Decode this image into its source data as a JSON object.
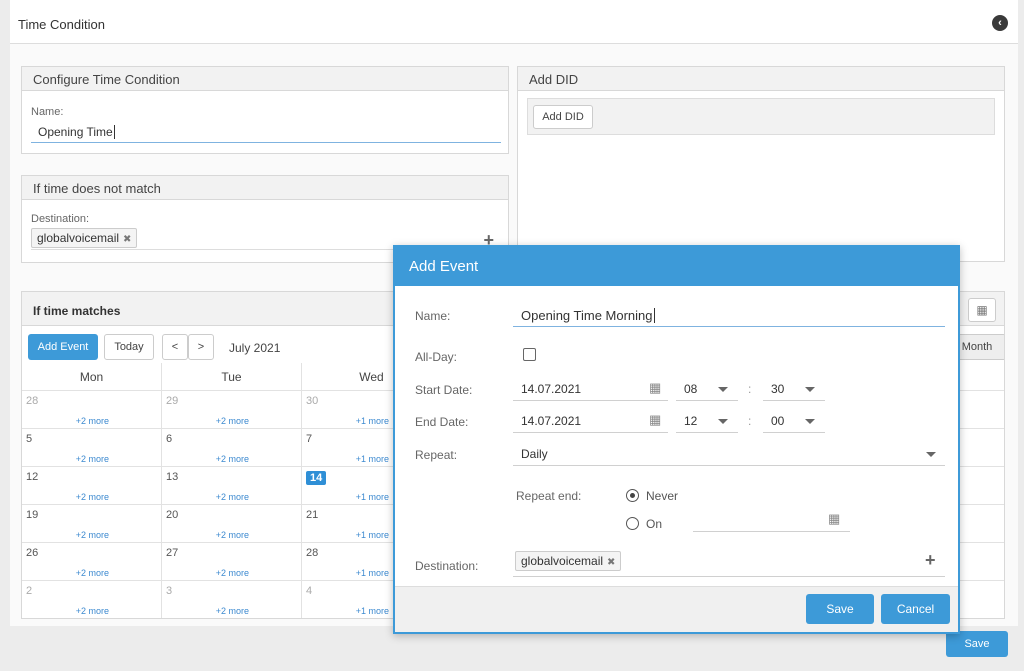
{
  "header": {
    "title": "Time Condition",
    "back_icon": "back-circle-icon"
  },
  "configure": {
    "title": "Configure Time Condition",
    "name_label": "Name:",
    "name_value": "Opening Time"
  },
  "add_did": {
    "title": "Add DID",
    "button": "Add DID"
  },
  "no_match": {
    "title": "If time does not match",
    "destination_label": "Destination:",
    "destination_tag": "globalvoicemail",
    "remove_glyph": "✖",
    "add_glyph": "+"
  },
  "matches": {
    "title": "If time matches",
    "add_event": "Add Event",
    "today": "Today",
    "prev": "<",
    "next": ">",
    "period": "July 2021",
    "view_month": "Month",
    "grid_icon": "grid-icon",
    "weekdays": [
      "Mon",
      "Tue",
      "Wed"
    ],
    "weeks": [
      [
        {
          "n": "28",
          "more": "+2 more",
          "dim": true
        },
        {
          "n": "29",
          "more": "+2 more",
          "dim": true
        },
        {
          "n": "30",
          "more": "+1 more",
          "dim": true
        }
      ],
      [
        {
          "n": "5",
          "more": "+2 more"
        },
        {
          "n": "6",
          "more": "+2 more"
        },
        {
          "n": "7",
          "more": "+1 more"
        }
      ],
      [
        {
          "n": "12",
          "more": "+2 more"
        },
        {
          "n": "13",
          "more": "+2 more"
        },
        {
          "n": "14",
          "more": "+1 more",
          "today": true
        }
      ],
      [
        {
          "n": "19",
          "more": "+2 more"
        },
        {
          "n": "20",
          "more": "+2 more"
        },
        {
          "n": "21",
          "more": "+1 more"
        }
      ],
      [
        {
          "n": "26",
          "more": "+2 more"
        },
        {
          "n": "27",
          "more": "+2 more"
        },
        {
          "n": "28",
          "more": "+1 more"
        }
      ],
      [
        {
          "n": "2",
          "more": "+2 more",
          "dim": true
        },
        {
          "n": "3",
          "more": "+2 more",
          "dim": true
        },
        {
          "n": "4",
          "more": "+1 more",
          "dim": true
        }
      ]
    ]
  },
  "footer": {
    "save": "Save"
  },
  "modal": {
    "title": "Add Event",
    "name_label": "Name:",
    "name_value": "Opening Time Morning",
    "allday_label": "All-Day:",
    "start_label": "Start Date:",
    "start_date": "14.07.2021",
    "start_hour": "08",
    "start_min": "30",
    "end_label": "End Date:",
    "end_date": "14.07.2021",
    "end_hour": "12",
    "end_min": "00",
    "time_sep": ":",
    "repeat_label": "Repeat:",
    "repeat_value": "Daily",
    "repeat_end_label": "Repeat end:",
    "never_label": "Never",
    "on_label": "On",
    "destination_label": "Destination:",
    "destination_tag": "globalvoicemail",
    "remove_glyph": "✖",
    "add_glyph": "+",
    "save": "Save",
    "cancel": "Cancel"
  },
  "colors": {
    "accent": "#3d9ad8",
    "today": "#2f8fd6",
    "link": "#3d8ad0"
  }
}
